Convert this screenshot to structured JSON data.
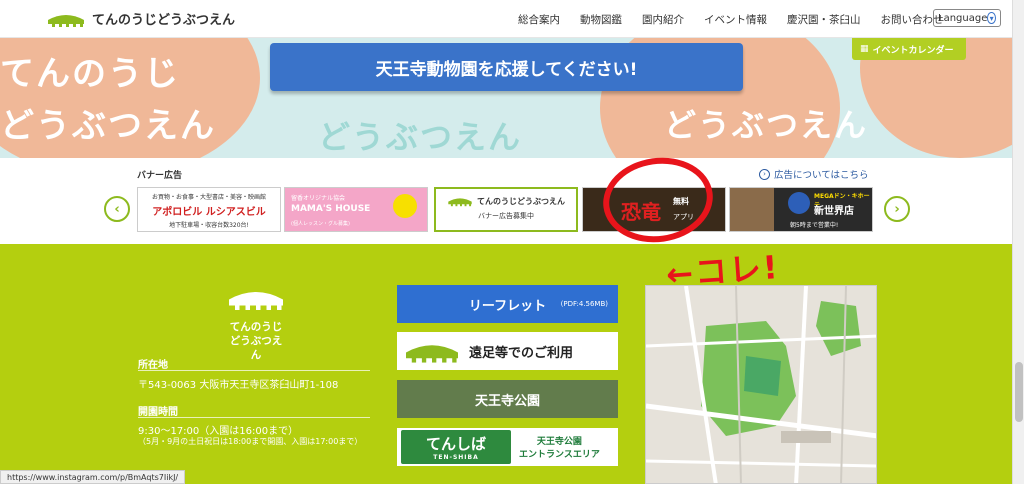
{
  "header": {
    "logo_text": "てんのうじどうぶつえん",
    "nav": [
      "総合案内",
      "動物図鑑",
      "園内紹介",
      "イベント情報",
      "慶沢園・茶臼山",
      "お問い合わせ"
    ],
    "language_label": "Language"
  },
  "hero": {
    "words": [
      "てんのうじ",
      "どうぶつえん",
      "どうぶつえん",
      "どうぶつえん"
    ],
    "support_button": "天王寺動物園を応援してください!",
    "event_calendar": "イベントカレンダー"
  },
  "banners": {
    "title": "バナー広告",
    "ad_info_link": "広告についてはこちら",
    "items": [
      {
        "line1": "お買物・お食事・大型書店・美容・映画館",
        "line2": "アポロビル ルシアスビル",
        "line3": "地下駐車場・収容台数320台!"
      },
      {
        "line1": "留香オリジナル協会",
        "line2": "MAMA'S HOUSE",
        "line3": "(個人レッスン・グル募集)"
      },
      {
        "line1": "てんのうじどうぶつえん",
        "line2": "バナー広告募集中"
      },
      {
        "line1": "恐竜",
        "line2": "無料",
        "line3": "アプリ"
      },
      {
        "line1": "MEGAドン・キホーテ",
        "line2": "新世界店",
        "line3": "朝5時まで営業中!"
      }
    ]
  },
  "annotation": {
    "text": "←コレ!"
  },
  "footer": {
    "logo_text_1": "てんのうじ",
    "logo_text_2": "どうぶつえん",
    "address_label": "所在地",
    "address": "〒543-0063 大阪市天王寺区茶臼山町1-108",
    "hours_label": "開園時間",
    "hours": "9:30〜17:00（入園は16:00まで）",
    "hours_note": "（5月・9月の土日祝日は18:00まで開園、入園は17:00まで）",
    "buttons": {
      "leaflet": "リーフレット",
      "leaflet_pdf": "(PDF:4.56MB)",
      "excursion": "遠足等でのご利用",
      "park": "天王寺公園",
      "tenshiba_logo": "てんしば",
      "tenshiba_sub": "TEN-SHIBA",
      "tenshiba_text_1": "天王寺公園",
      "tenshiba_text_2": "エントランスエリア"
    }
  },
  "statusbar": {
    "url": "https://www.instagram.com/p/BmAqts7IikJ/"
  },
  "colors": {
    "accent_green": "#b4cf0f",
    "button_blue": "#3a73c9",
    "annotation_red": "#e8141b"
  }
}
